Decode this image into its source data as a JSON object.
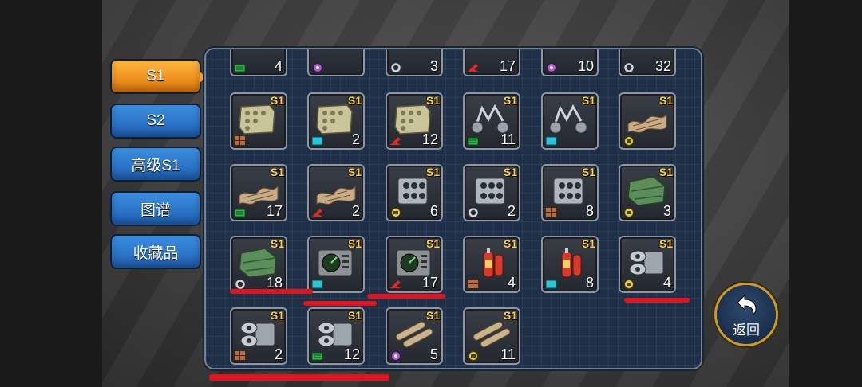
{
  "tabs": [
    {
      "label": "S1",
      "active": true
    },
    {
      "label": "S2",
      "active": false
    },
    {
      "label": "高级S1",
      "active": false
    },
    {
      "label": "图谱",
      "active": false
    },
    {
      "label": "收藏品",
      "active": false
    }
  ],
  "back_button": {
    "label": "返回"
  },
  "tier_label": "S1",
  "colors": {
    "tier": "#ffd23c",
    "active_tab": "#f0a030",
    "tab": "#2a76cc",
    "panel": "#1e2f47",
    "markup": "#e0141e"
  },
  "partial_row": [
    {
      "count": "4",
      "icon": "flag-icon"
    },
    {
      "count": "",
      "icon": "purple-part-icon"
    },
    {
      "count": "3",
      "icon": "gear-part-icon"
    },
    {
      "count": "17",
      "icon": "red-part-icon"
    },
    {
      "count": "10",
      "icon": "purple-part-icon"
    },
    {
      "count": "32",
      "icon": "gear-part-icon"
    }
  ],
  "items": [
    {
      "art": "armor-plate",
      "count": "",
      "source": "brown"
    },
    {
      "art": "armor-plate",
      "count": "2",
      "source": "teal"
    },
    {
      "art": "armor-plate",
      "count": "12",
      "source": "red"
    },
    {
      "art": "wheels",
      "count": "11",
      "source": "green"
    },
    {
      "art": "wheels",
      "count": "",
      "source": "teal"
    },
    {
      "art": "camo-net",
      "count": "",
      "source": "yellow"
    },
    {
      "art": "camo-net",
      "count": "17",
      "source": "green"
    },
    {
      "art": "camo-net",
      "count": "2",
      "source": "red"
    },
    {
      "art": "launcher",
      "count": "6",
      "source": "yellow"
    },
    {
      "art": "launcher",
      "count": "2",
      "source": "gear"
    },
    {
      "art": "launcher",
      "count": "8",
      "source": "brown"
    },
    {
      "art": "green-plate",
      "count": "3",
      "source": "yellow"
    },
    {
      "art": "green-plate",
      "count": "18",
      "source": "gear"
    },
    {
      "art": "radar-box",
      "count": "",
      "source": "teal"
    },
    {
      "art": "radar-box",
      "count": "17",
      "source": "red"
    },
    {
      "art": "extinguisher",
      "count": "4",
      "source": "brown"
    },
    {
      "art": "extinguisher",
      "count": "8",
      "source": "teal"
    },
    {
      "art": "twin-barrel",
      "count": "4",
      "source": "yellow"
    },
    {
      "art": "twin-barrel",
      "count": "2",
      "source": "brown"
    },
    {
      "art": "twin-barrel",
      "count": "12",
      "source": "green"
    },
    {
      "art": "rollers",
      "count": "5",
      "source": "purple"
    },
    {
      "art": "rollers",
      "count": "11",
      "source": "yellow"
    }
  ]
}
